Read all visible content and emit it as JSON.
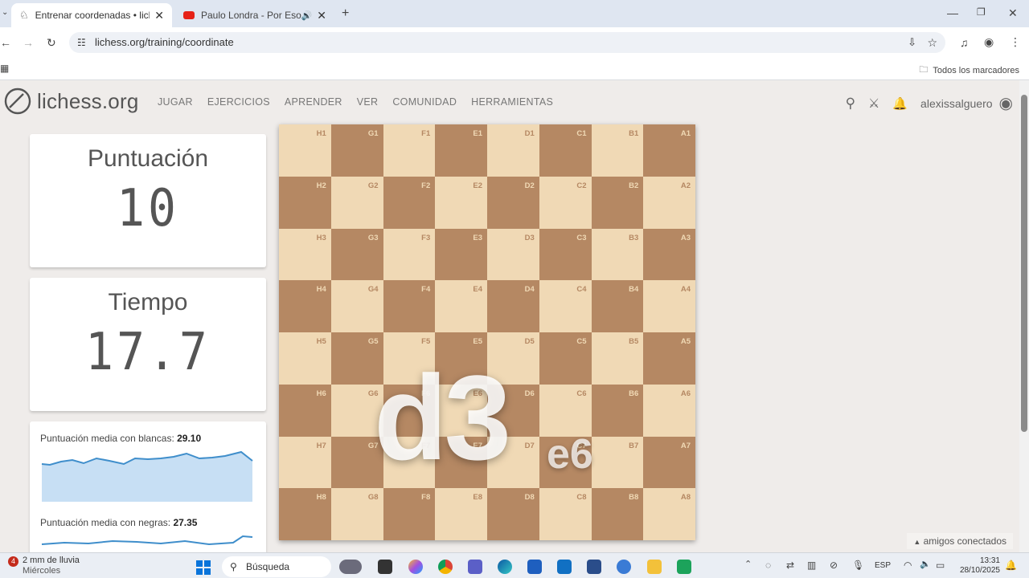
{
  "browser": {
    "tabs": [
      {
        "title": "Entrenar coordenadas • lichess.org",
        "active": true
      },
      {
        "title": "Paulo Londra - Por Eso Vine",
        "active": false
      }
    ],
    "url": "lichess.org/training/coordinate",
    "bookmarks_label": "Todos los marcadores"
  },
  "site": {
    "logo": "lichess.org",
    "nav": [
      "JUGAR",
      "EJERCICIOS",
      "APRENDER",
      "VER",
      "COMUNIDAD",
      "HERRAMIENTAS"
    ],
    "username": "alexissalguero"
  },
  "score": {
    "label": "Puntuación",
    "value": "10"
  },
  "time": {
    "label": "Tiempo",
    "value": "17.7"
  },
  "stats": {
    "white_label": "Puntuación media con blancas:",
    "white_value": "29.10",
    "black_label": "Puntuación media con negras:",
    "black_value": "27.35"
  },
  "board": {
    "orientation": "black",
    "files": [
      "H",
      "G",
      "F",
      "E",
      "D",
      "C",
      "B",
      "A"
    ],
    "ranks": [
      "1",
      "2",
      "3",
      "4",
      "5",
      "6",
      "7",
      "8"
    ],
    "current_coordinate": "d3",
    "next_coordinate": "e6"
  },
  "friends_label": "amigos conectados",
  "taskbar": {
    "weather": "2 mm de lluvia",
    "weather_day": "Miércoles",
    "notification_count": "4",
    "search_placeholder": "Búsqueda",
    "language": "ESP",
    "time": "13:31",
    "date": "28/10/2025"
  }
}
